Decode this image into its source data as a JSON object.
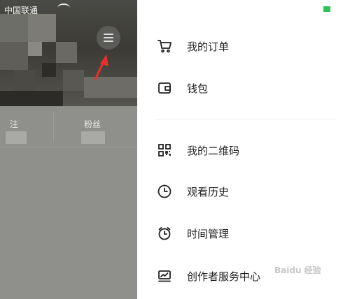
{
  "status_bar": {
    "carrier": "中国联通"
  },
  "profile": {
    "stats": [
      {
        "label": "注"
      },
      {
        "label": "粉丝"
      }
    ]
  },
  "drawer": {
    "items": [
      {
        "label": "我的订单",
        "icon": "cart-icon"
      },
      {
        "label": "钱包",
        "icon": "wallet-icon"
      },
      {
        "label": "我的二维码",
        "icon": "qrcode-icon"
      },
      {
        "label": "观看历史",
        "icon": "clock-icon"
      },
      {
        "label": "时间管理",
        "icon": "alarm-clock-icon"
      },
      {
        "label": "创作者服务中心",
        "icon": "chart-monitor-icon"
      }
    ]
  },
  "watermark": "Baidu 经验",
  "colors": {
    "arrow": "#e8302a",
    "battery": "#2ec25a",
    "overlay": "#8f8f8b"
  }
}
